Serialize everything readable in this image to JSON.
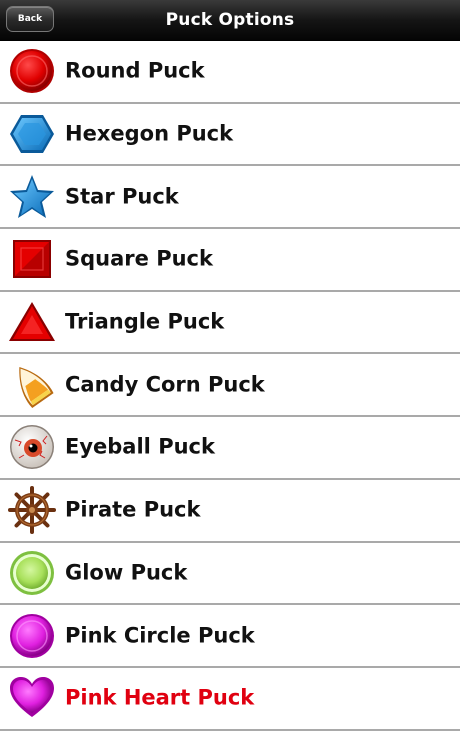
{
  "navbar": {
    "back_label": "Back",
    "title": "Puck Options"
  },
  "puck_list": [
    {
      "label": "Round Puck",
      "icon": "round-puck-icon",
      "color": "#e00000"
    },
    {
      "label": "Hexegon Puck",
      "icon": "hexagon-puck-icon",
      "color": "#1e90d8"
    },
    {
      "label": "Star Puck",
      "icon": "star-puck-icon",
      "color": "#1e90d8"
    },
    {
      "label": "Square Puck",
      "icon": "square-puck-icon",
      "color": "#d80000"
    },
    {
      "label": "Triangle Puck",
      "icon": "triangle-puck-icon",
      "color": "#e00000"
    },
    {
      "label": "Candy Corn Puck",
      "icon": "candy-corn-puck-icon",
      "color": "#f4a020"
    },
    {
      "label": "Eyeball Puck",
      "icon": "eyeball-puck-icon",
      "color": "#d84a2a"
    },
    {
      "label": "Pirate Puck",
      "icon": "ship-wheel-puck-icon",
      "color": "#7a3a14"
    },
    {
      "label": "Glow Puck",
      "icon": "glow-puck-icon",
      "color": "#a8e05a"
    },
    {
      "label": "Pink Circle Puck",
      "icon": "pink-circle-puck-icon",
      "color": "#e020e0"
    },
    {
      "label": "Pink Heart Puck",
      "icon": "pink-heart-puck-icon",
      "color": "#e020e0"
    }
  ]
}
